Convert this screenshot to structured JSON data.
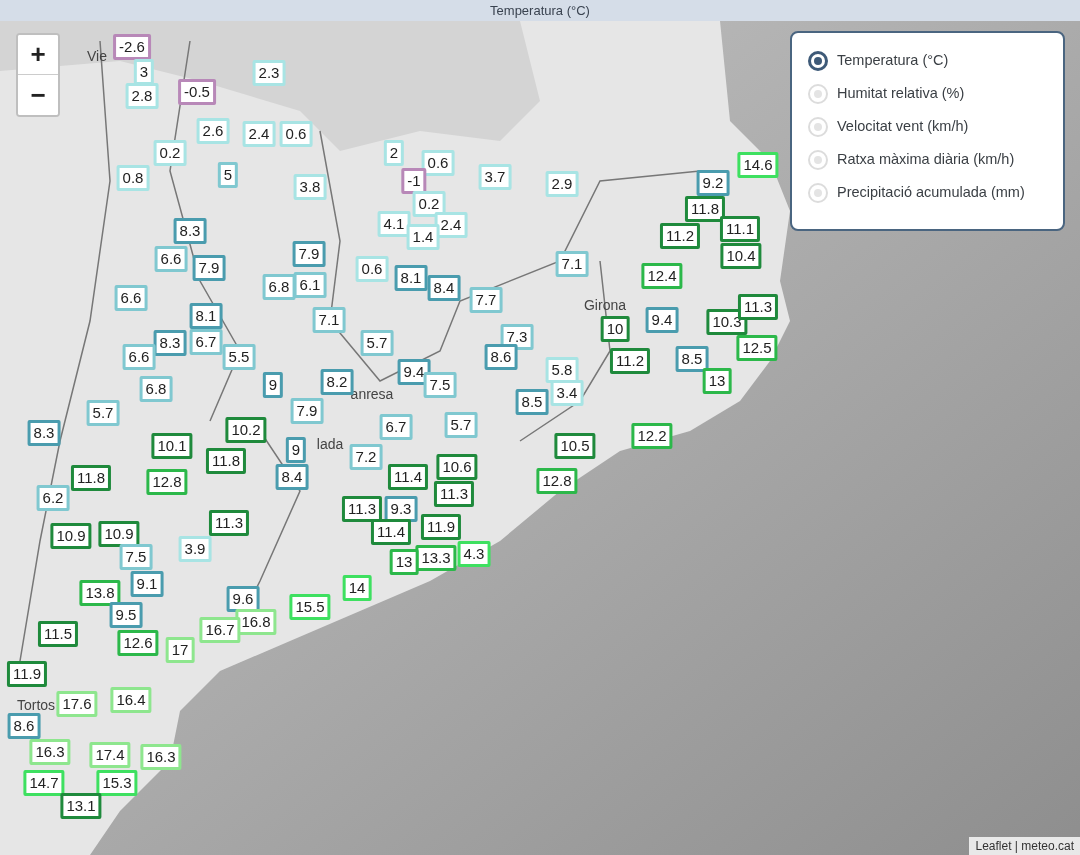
{
  "window": {
    "title": "Temperatura (°C)"
  },
  "zoom_controls": [
    "+",
    "−"
  ],
  "legend": {
    "options": [
      {
        "label": "Temperatura (°C)",
        "selected": true
      },
      {
        "label": "Humitat relativa (%)",
        "selected": false
      },
      {
        "label": "Velocitat vent (km/h)",
        "selected": false
      },
      {
        "label": "Ratxa màxima diària (km/h)",
        "selected": false
      },
      {
        "label": "Precipitació acumulada (mm)",
        "selected": false
      }
    ]
  },
  "place_labels": [
    "Vie",
    "Girona",
    "anresa",
    "lada",
    "Tortos"
  ],
  "stations": [
    {
      "value": "-2.6",
      "color": "#b888b8"
    },
    {
      "value": "3",
      "color": "#a8e4e4"
    },
    {
      "value": "2.8",
      "color": "#a8e4e4"
    },
    {
      "value": "-0.5",
      "color": "#b888b8"
    },
    {
      "value": "2.3",
      "color": "#a8e4e4"
    },
    {
      "value": "2.6",
      "color": "#a8e4e4"
    },
    {
      "value": "2.4",
      "color": "#a8e4e4"
    },
    {
      "value": "0.6",
      "color": "#a8e4e4"
    },
    {
      "value": "0.2",
      "color": "#a8e4e4"
    },
    {
      "value": "0.8",
      "color": "#a8e4e4"
    },
    {
      "value": "5",
      "color": "#80c8d0"
    },
    {
      "value": "3.8",
      "color": "#a8e4e4"
    },
    {
      "value": "2",
      "color": "#a8e4e4"
    },
    {
      "value": "0.6",
      "color": "#a8e4e4"
    },
    {
      "value": "-1",
      "color": "#b888b8"
    },
    {
      "value": "0.2",
      "color": "#a8e4e4"
    },
    {
      "value": "3.7",
      "color": "#a8e4e4"
    },
    {
      "value": "2.9",
      "color": "#a8e4e4"
    },
    {
      "value": "4.1",
      "color": "#a8e4e4"
    },
    {
      "value": "2.4",
      "color": "#a8e4e4"
    },
    {
      "value": "1.4",
      "color": "#a8e4e4"
    },
    {
      "value": "14.6",
      "color": "#3ee060"
    },
    {
      "value": "9.2",
      "color": "#4a9cae"
    },
    {
      "value": "11.8",
      "color": "#1f8a3c"
    },
    {
      "value": "11.2",
      "color": "#1f8a3c"
    },
    {
      "value": "11.1",
      "color": "#1f8a3c"
    },
    {
      "value": "10.4",
      "color": "#1f8a3c"
    },
    {
      "value": "12.4",
      "color": "#2cb84a"
    },
    {
      "value": "8.3",
      "color": "#4a9cae"
    },
    {
      "value": "6.6",
      "color": "#80c8d0"
    },
    {
      "value": "7.9",
      "color": "#4a9cae"
    },
    {
      "value": "7.9",
      "color": "#4a9cae"
    },
    {
      "value": "0.6",
      "color": "#a8e4e4"
    },
    {
      "value": "8.1",
      "color": "#4a9cae"
    },
    {
      "value": "8.4",
      "color": "#4a9cae"
    },
    {
      "value": "7.1",
      "color": "#80c8d0"
    },
    {
      "value": "6.8",
      "color": "#80c8d0"
    },
    {
      "value": "6.1",
      "color": "#80c8d0"
    },
    {
      "value": "6.6",
      "color": "#80c8d0"
    },
    {
      "value": "8.1",
      "color": "#4a9cae"
    },
    {
      "value": "7.1",
      "color": "#80c8d0"
    },
    {
      "value": "7.7",
      "color": "#80c8d0"
    },
    {
      "value": "10",
      "color": "#1f8a3c"
    },
    {
      "value": "9.4",
      "color": "#4a9cae"
    },
    {
      "value": "10.3",
      "color": "#1f8a3c"
    },
    {
      "value": "11.3",
      "color": "#1f8a3c"
    },
    {
      "value": "12.5",
      "color": "#2cb84a"
    },
    {
      "value": "11.2",
      "color": "#1f8a3c"
    },
    {
      "value": "8.5",
      "color": "#4a9cae"
    },
    {
      "value": "13",
      "color": "#2cb84a"
    },
    {
      "value": "8.3",
      "color": "#4a9cae"
    },
    {
      "value": "6.7",
      "color": "#80c8d0"
    },
    {
      "value": "6.6",
      "color": "#80c8d0"
    },
    {
      "value": "5.5",
      "color": "#80c8d0"
    },
    {
      "value": "5.7",
      "color": "#80c8d0"
    },
    {
      "value": "7.3",
      "color": "#80c8d0"
    },
    {
      "value": "8.6",
      "color": "#4a9cae"
    },
    {
      "value": "9",
      "color": "#4a9cae"
    },
    {
      "value": "8.2",
      "color": "#4a9cae"
    },
    {
      "value": "9.4",
      "color": "#4a9cae"
    },
    {
      "value": "7.5",
      "color": "#80c8d0"
    },
    {
      "value": "5.8",
      "color": "#a8e4e4"
    },
    {
      "value": "3.4",
      "color": "#a8e4e4"
    },
    {
      "value": "8.5",
      "color": "#4a9cae"
    },
    {
      "value": "6.8",
      "color": "#80c8d0"
    },
    {
      "value": "5.7",
      "color": "#80c8d0"
    },
    {
      "value": "7.9",
      "color": "#80c8d0"
    },
    {
      "value": "8.3",
      "color": "#4a9cae"
    },
    {
      "value": "10.2",
      "color": "#1f8a3c"
    },
    {
      "value": "11.8",
      "color": "#1f8a3c"
    },
    {
      "value": "9",
      "color": "#4a9cae"
    },
    {
      "value": "10.1",
      "color": "#1f8a3c"
    },
    {
      "value": "12.8",
      "color": "#2cb84a"
    },
    {
      "value": "11.8",
      "color": "#1f8a3c"
    },
    {
      "value": "6.7",
      "color": "#80c8d0"
    },
    {
      "value": "5.7",
      "color": "#80c8d0"
    },
    {
      "value": "7.2",
      "color": "#80c8d0"
    },
    {
      "value": "10.5",
      "color": "#1f8a3c"
    },
    {
      "value": "12.2",
      "color": "#2cb84a"
    },
    {
      "value": "10.6",
      "color": "#1f8a3c"
    },
    {
      "value": "11.4",
      "color": "#1f8a3c"
    },
    {
      "value": "12.8",
      "color": "#2cb84a"
    },
    {
      "value": "8.4",
      "color": "#4a9cae"
    },
    {
      "value": "11.3",
      "color": "#1f8a3c"
    },
    {
      "value": "6.2",
      "color": "#80c8d0"
    },
    {
      "value": "9.3",
      "color": "#4a9cae"
    },
    {
      "value": "11.3",
      "color": "#1f8a3c"
    },
    {
      "value": "11.3",
      "color": "#1f8a3c"
    },
    {
      "value": "10.9",
      "color": "#1f8a3c"
    },
    {
      "value": "10.9",
      "color": "#1f8a3c"
    },
    {
      "value": "11.4",
      "color": "#1f8a3c"
    },
    {
      "value": "11.9",
      "color": "#1f8a3c"
    },
    {
      "value": "3.9",
      "color": "#a8e4e4"
    },
    {
      "value": "7.5",
      "color": "#80c8d0"
    },
    {
      "value": "13.3",
      "color": "#2cb84a"
    },
    {
      "value": "13",
      "color": "#2cb84a"
    },
    {
      "value": "4.3",
      "color": "#3ee060"
    },
    {
      "value": "9.1",
      "color": "#4a9cae"
    },
    {
      "value": "13.8",
      "color": "#2cb84a"
    },
    {
      "value": "14",
      "color": "#3ee060"
    },
    {
      "value": "9.6",
      "color": "#4a9cae"
    },
    {
      "value": "15.5",
      "color": "#3ee060"
    },
    {
      "value": "16.8",
      "color": "#8ee68e"
    },
    {
      "value": "16.7",
      "color": "#8ee68e"
    },
    {
      "value": "9.5",
      "color": "#4a9cae"
    },
    {
      "value": "12.6",
      "color": "#2cb84a"
    },
    {
      "value": "11.5",
      "color": "#1f8a3c"
    },
    {
      "value": "17",
      "color": "#8ee68e"
    },
    {
      "value": "11.9",
      "color": "#1f8a3c"
    },
    {
      "value": "17.6",
      "color": "#8ee68e"
    },
    {
      "value": "16.4",
      "color": "#8ee68e"
    },
    {
      "value": "8.6",
      "color": "#4a9cae"
    },
    {
      "value": "16.3",
      "color": "#8ee68e"
    },
    {
      "value": "17.4",
      "color": "#8ee68e"
    },
    {
      "value": "16.3",
      "color": "#8ee68e"
    },
    {
      "value": "14.7",
      "color": "#3ee060"
    },
    {
      "value": "15.3",
      "color": "#3ee060"
    },
    {
      "value": "13.1",
      "color": "#1f8a3c"
    }
  ],
  "attribution": "Leaflet | meteo.cat"
}
